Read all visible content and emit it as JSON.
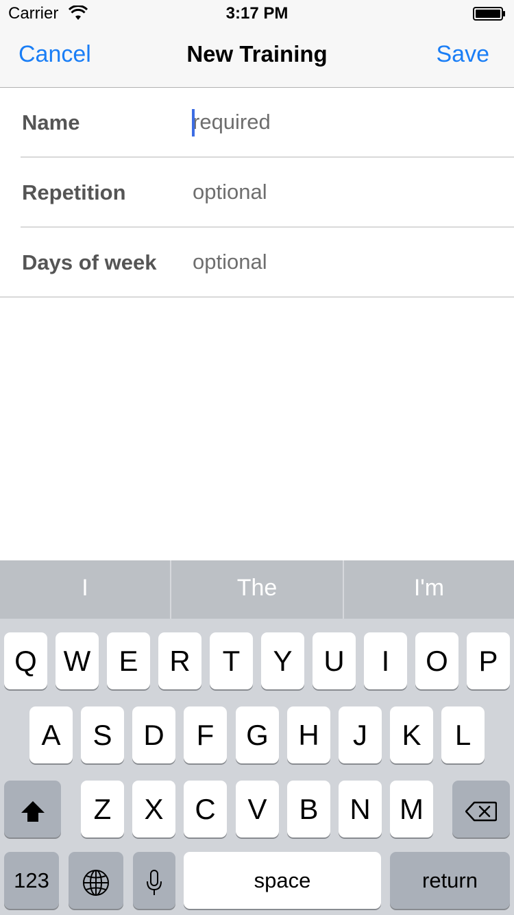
{
  "status_bar": {
    "carrier": "Carrier",
    "time": "3:17 PM",
    "wifi_icon": "wifi-icon",
    "battery_icon": "battery-icon"
  },
  "nav": {
    "cancel": "Cancel",
    "title": "New Training",
    "save": "Save"
  },
  "form": {
    "rows": [
      {
        "label": "Name",
        "placeholder": "required",
        "value": ""
      },
      {
        "label": "Repetition",
        "placeholder": "optional",
        "value": ""
      },
      {
        "label": "Days of week",
        "placeholder": "optional",
        "value": ""
      }
    ]
  },
  "keyboard": {
    "suggestions": [
      "I",
      "The",
      "I'm"
    ],
    "row1": [
      "Q",
      "W",
      "E",
      "R",
      "T",
      "Y",
      "U",
      "I",
      "O",
      "P"
    ],
    "row2": [
      "A",
      "S",
      "D",
      "F",
      "G",
      "H",
      "J",
      "K",
      "L"
    ],
    "row3": [
      "Z",
      "X",
      "C",
      "V",
      "B",
      "N",
      "M"
    ],
    "numbers_key": "123",
    "space_key": "space",
    "return_key": "return",
    "icons": [
      "shift-icon",
      "backspace-icon",
      "globe-icon",
      "microphone-icon"
    ]
  },
  "colors": {
    "accent": "#1a7ef6",
    "caret": "#3d6de3",
    "keyboard_bg": "#d1d4d9"
  }
}
